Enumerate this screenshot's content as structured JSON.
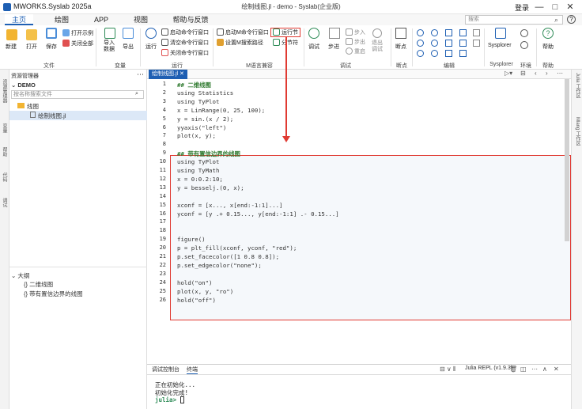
{
  "app": {
    "title": "MWORKS.Syslab 2025a",
    "window_title": "绘制线图.jl - demo - Syslab(企业版)",
    "login": "登录"
  },
  "menu": [
    "主页",
    "绘图",
    "APP",
    "视图",
    "帮助与反馈"
  ],
  "search": {
    "placeholder": "搜索"
  },
  "ribbon": {
    "file": {
      "new": "新建",
      "open": "打开",
      "save": "保存",
      "open_example": "打开示例",
      "close_all": "关闭全部",
      "group": "文件"
    },
    "variable": {
      "import": "导入数据",
      "export": "导出",
      "group": "变量"
    },
    "run": {
      "run": "运行",
      "start_cmd": "启动命令行窗口",
      "clear_cmd": "清空命令行窗口",
      "close_cmd": "关闭命令行窗口",
      "group": "运行"
    },
    "m": {
      "start_m": "启动M命令行窗口",
      "set_m_path": "设置M搜索路径",
      "run_section": "运行节",
      "step_section": "分节符",
      "group": "M语言兼容"
    },
    "debug": {
      "debug": "调试",
      "step": "步进",
      "step_in": "步入",
      "step_out": "步出",
      "restart": "重启",
      "quit": "退出调试",
      "group": "调试"
    },
    "breakpoint": {
      "label": "断点",
      "group": "断点"
    },
    "edit": {
      "group": "编辑"
    },
    "sysplorer": {
      "label": "Sysplorer",
      "group": "Sysplorer"
    },
    "env": {
      "group": "环境"
    },
    "help": {
      "label": "帮助",
      "group": "帮助"
    }
  },
  "left_tabs": [
    "资源管理器",
    "变量",
    "帮助",
    "代码",
    "调试"
  ],
  "explorer": {
    "title": "资源管理器",
    "project": "DEMO",
    "search_placeholder": "按名称搜索文件",
    "folder": "线图",
    "file": "绘制线图.jl"
  },
  "outline": {
    "title": "大纲",
    "items": [
      "二维线图",
      "带有置信边界的线图"
    ]
  },
  "editor": {
    "tab": "绘制线图.jl",
    "lines": [
      {
        "n": "1",
        "t": "## 二维线图",
        "c": true
      },
      {
        "n": "2",
        "t": "using Statistics"
      },
      {
        "n": "3",
        "t": "using TyPlot"
      },
      {
        "n": "4",
        "t": "x = LinRange(0, 25, 100);"
      },
      {
        "n": "5",
        "t": "y = sin.(x / 2);"
      },
      {
        "n": "6",
        "t": "yyaxis(\"left\")"
      },
      {
        "n": "7",
        "t": "plot(x, y);"
      },
      {
        "n": "8",
        "t": ""
      },
      {
        "n": "9",
        "t": "## 带有置信边界的线图",
        "c": true
      },
      {
        "n": "10",
        "t": "using TyPlot"
      },
      {
        "n": "11",
        "t": "using TyMath"
      },
      {
        "n": "12",
        "t": "x = 0:0.2:10;"
      },
      {
        "n": "13",
        "t": "y = besselj.(0, x);"
      },
      {
        "n": "14",
        "t": ""
      },
      {
        "n": "15",
        "t": "xconf = [x..., x[end:-1:1]...]"
      },
      {
        "n": "16",
        "t": "yconf = [y .+ 0.15..., y[end:-1:1] .- 0.15...]"
      },
      {
        "n": "17",
        "t": ""
      },
      {
        "n": "18",
        "t": ""
      },
      {
        "n": "19",
        "t": "figure()"
      },
      {
        "n": "20",
        "t": "p = plt_fill(xconf, yconf, \"red\");"
      },
      {
        "n": "21",
        "t": "p.set_facecolor([1 0.8 0.8]);"
      },
      {
        "n": "22",
        "t": "p.set_edgecolor(\"none\");"
      },
      {
        "n": "23",
        "t": ""
      },
      {
        "n": "24",
        "t": "hold(\"on\")"
      },
      {
        "n": "25",
        "t": "plot(x, y, \"ro\")"
      },
      {
        "n": "26",
        "t": "hold(\"off\")"
      }
    ]
  },
  "right_tabs": [
    "Julia 工作区",
    "Mlang 工作区"
  ],
  "console": {
    "tabs": [
      "调试控制台",
      "终端"
    ],
    "repl": "Julia REPL (v1.9.3)",
    "lines": [
      "正在初始化...",
      "初始化完成!",
      "julia> "
    ]
  }
}
